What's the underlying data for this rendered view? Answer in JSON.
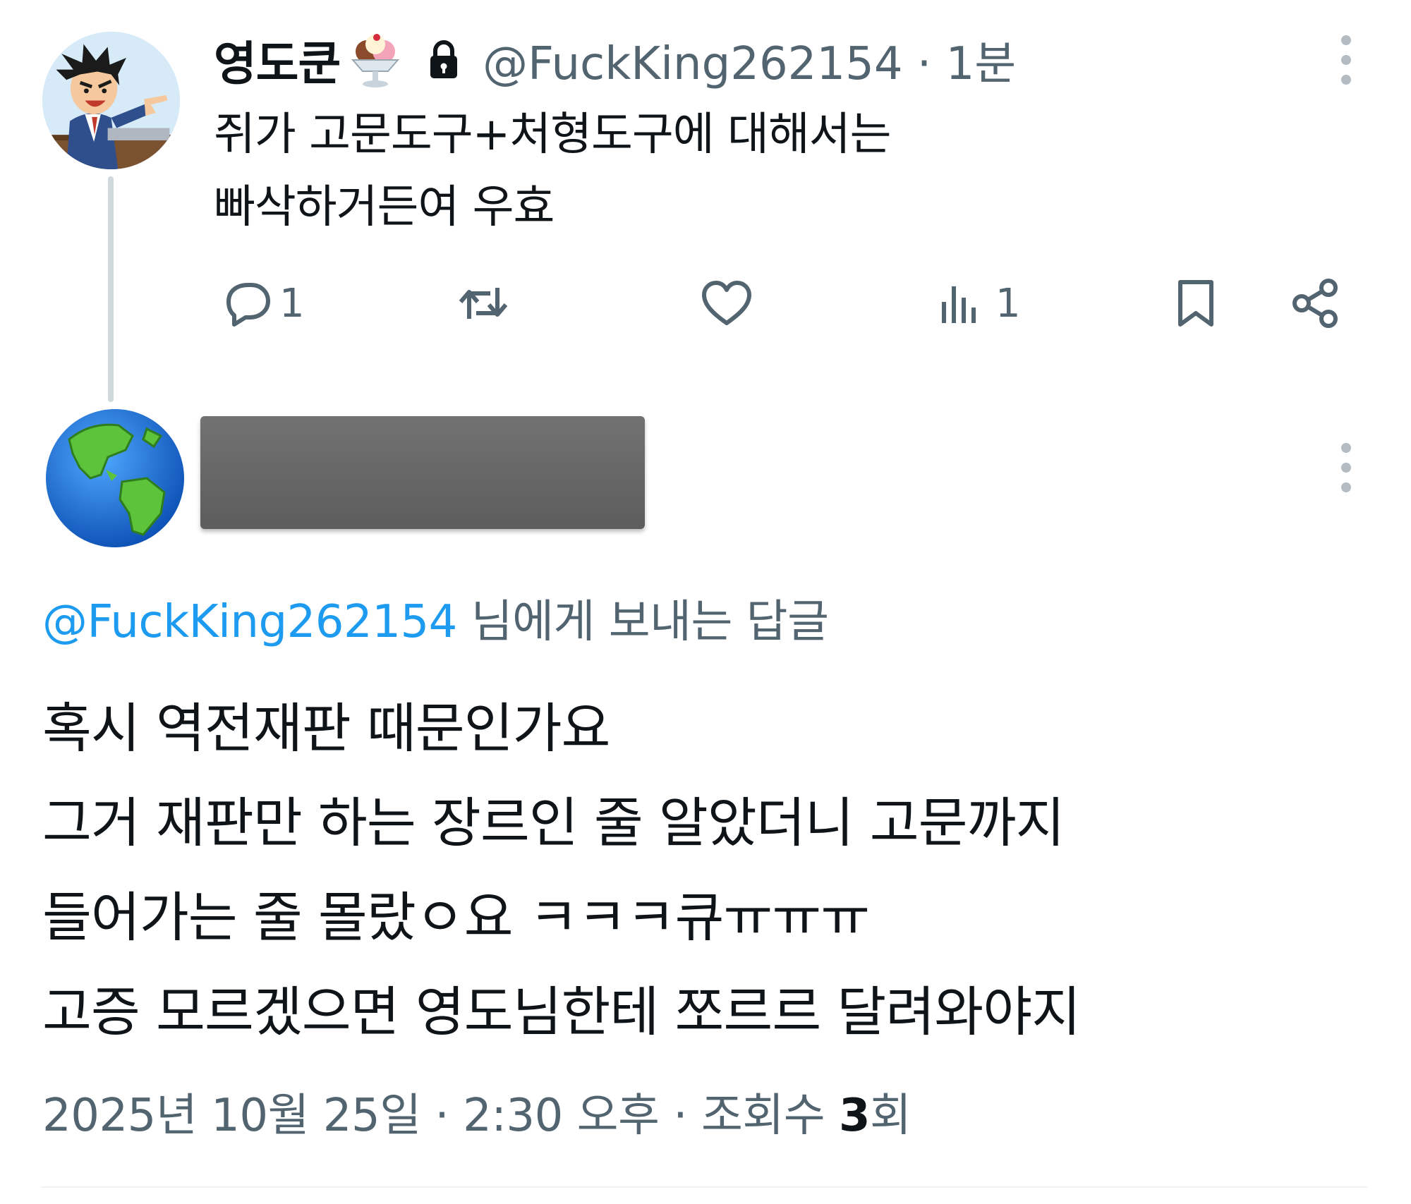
{
  "tweet": {
    "author_name": "영도쿤",
    "handle": "@FuckKing262154",
    "separator": "·",
    "time_ago": "1분",
    "text_lines": [
      "쥐가 고문도구+처형도구에 대해서는",
      "빠삭하거든여 우효"
    ],
    "icons": {
      "avatar": "lawyer-pointing-avatar",
      "name_emoji": "ice-cream-sundae-icon",
      "protected": "lock-icon",
      "more": "more-vertical-icon"
    },
    "actions": {
      "reply_count": "1",
      "retweet_count": "",
      "like_count": "",
      "views_count": "1"
    }
  },
  "reply": {
    "avatar": "globe-americas-avatar",
    "reply_to_handle": "@FuckKing262154",
    "reply_to_suffix": " 님에게 보내는 답글",
    "lines": [
      "혹시 역전재판 때문인가요",
      "그거 재판만 하는 장르인 줄 알았더니 고문까지",
      "들어가는 줄 몰랐ㅇ요 ㅋㅋㅋ큐ㅠㅠㅠ",
      "고증 모르겠으면 영도님한테 쪼르르 달려와야지"
    ],
    "meta": {
      "date": "2025년 10월 25일",
      "sep1": " · ",
      "time": "2:30 오후",
      "sep2": " · ",
      "views_label": "조회수 ",
      "views_count": "3",
      "views_unit": "회"
    }
  },
  "colors": {
    "text": "#0f1419",
    "secondary": "#536471",
    "link": "#1d9bf0",
    "thread_line": "#cfd9de",
    "redaction": "#6a6a6a"
  }
}
